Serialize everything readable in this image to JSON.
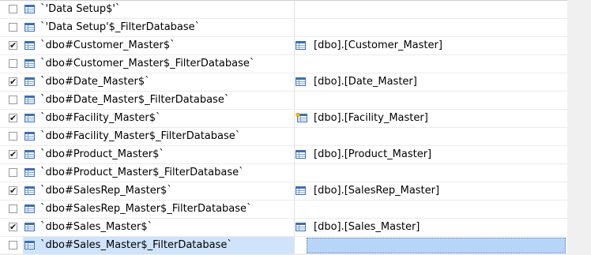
{
  "rows": [
    {
      "checked": false,
      "source": "`'Data Setup$'`",
      "destination": "",
      "dest_icon": "table-icon"
    },
    {
      "checked": false,
      "source": "`'Data Setup'$_FilterDatabase`",
      "destination": "",
      "dest_icon": "table-icon"
    },
    {
      "checked": true,
      "source": "`dbo#Customer_Master$`",
      "destination": "[dbo].[Customer_Master]",
      "dest_icon": "table-icon"
    },
    {
      "checked": false,
      "source": "`dbo#Customer_Master$_FilterDatabase`",
      "destination": "",
      "dest_icon": "table-icon"
    },
    {
      "checked": true,
      "source": "`dbo#Date_Master$`",
      "destination": "[dbo].[Date_Master]",
      "dest_icon": "table-icon"
    },
    {
      "checked": false,
      "source": "`dbo#Date_Master$_FilterDatabase`",
      "destination": "",
      "dest_icon": "table-icon"
    },
    {
      "checked": true,
      "source": "`dbo#Facility_Master$`",
      "destination": "[dbo].[Facility_Master]",
      "dest_icon": "new-table-icon"
    },
    {
      "checked": false,
      "source": "`dbo#Facility_Master$_FilterDatabase`",
      "destination": "",
      "dest_icon": "table-icon"
    },
    {
      "checked": true,
      "source": "`dbo#Product_Master$`",
      "destination": "[dbo].[Product_Master]",
      "dest_icon": "table-icon"
    },
    {
      "checked": false,
      "source": "`dbo#Product_Master$_FilterDatabase`",
      "destination": "",
      "dest_icon": "table-icon"
    },
    {
      "checked": true,
      "source": "`dbo#SalesRep_Master$`",
      "destination": "[dbo].[SalesRep_Master]",
      "dest_icon": "table-icon"
    },
    {
      "checked": false,
      "source": "`dbo#SalesRep_Master$_FilterDatabase`",
      "destination": "",
      "dest_icon": "table-icon"
    },
    {
      "checked": true,
      "source": "`dbo#Sales_Master$`",
      "destination": "[dbo].[Sales_Master]",
      "dest_icon": "table-icon"
    },
    {
      "checked": false,
      "source": "`dbo#Sales_Master$_FilterDatabase`",
      "destination": "",
      "dest_icon": "table-icon",
      "selected": true
    }
  ],
  "check_glyph": "✔",
  "colors": {
    "selection": "#cfe3fa",
    "selection_dest": "#b7d6f7",
    "icon_blue": "#3a6fb5"
  }
}
